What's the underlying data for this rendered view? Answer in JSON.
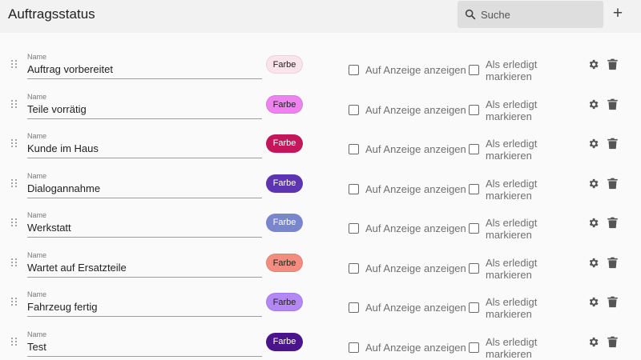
{
  "header": {
    "title": "Auftragsstatus",
    "search_placeholder": "Suche",
    "add_symbol": "+"
  },
  "labels": {
    "name_label": "Name",
    "color_button": "Farbe",
    "show_on_display": "Auf Anzeige anzeigen",
    "mark_done_line1": "Als erledigt",
    "mark_done_line2": "markieren"
  },
  "rows": [
    {
      "name": "Auftrag vorbereitet",
      "color": "#fce4ec",
      "text_color": "#212121",
      "show_on_display": false,
      "mark_done": false
    },
    {
      "name": "Teile vorrätig",
      "color": "#ee82ee",
      "text_color": "#212121",
      "show_on_display": false,
      "mark_done": false
    },
    {
      "name": "Kunde im Haus",
      "color": "#c2185b",
      "text_color": "#ffffff",
      "show_on_display": false,
      "mark_done": false
    },
    {
      "name": "Dialogannahme",
      "color": "#5e35b1",
      "text_color": "#ffffff",
      "show_on_display": false,
      "mark_done": false
    },
    {
      "name": "Werkstatt",
      "color": "#7986cb",
      "text_color": "#ffffff",
      "show_on_display": false,
      "mark_done": false
    },
    {
      "name": "Wartet auf Ersatzteile",
      "color": "#f48c7f",
      "text_color": "#212121",
      "show_on_display": false,
      "mark_done": false
    },
    {
      "name": "Fahrzeug fertig",
      "color": "#b388f5",
      "text_color": "#212121",
      "show_on_display": false,
      "mark_done": false
    },
    {
      "name": "Test",
      "color": "#4a148c",
      "text_color": "#ffffff",
      "show_on_display": false,
      "mark_done": false
    }
  ]
}
